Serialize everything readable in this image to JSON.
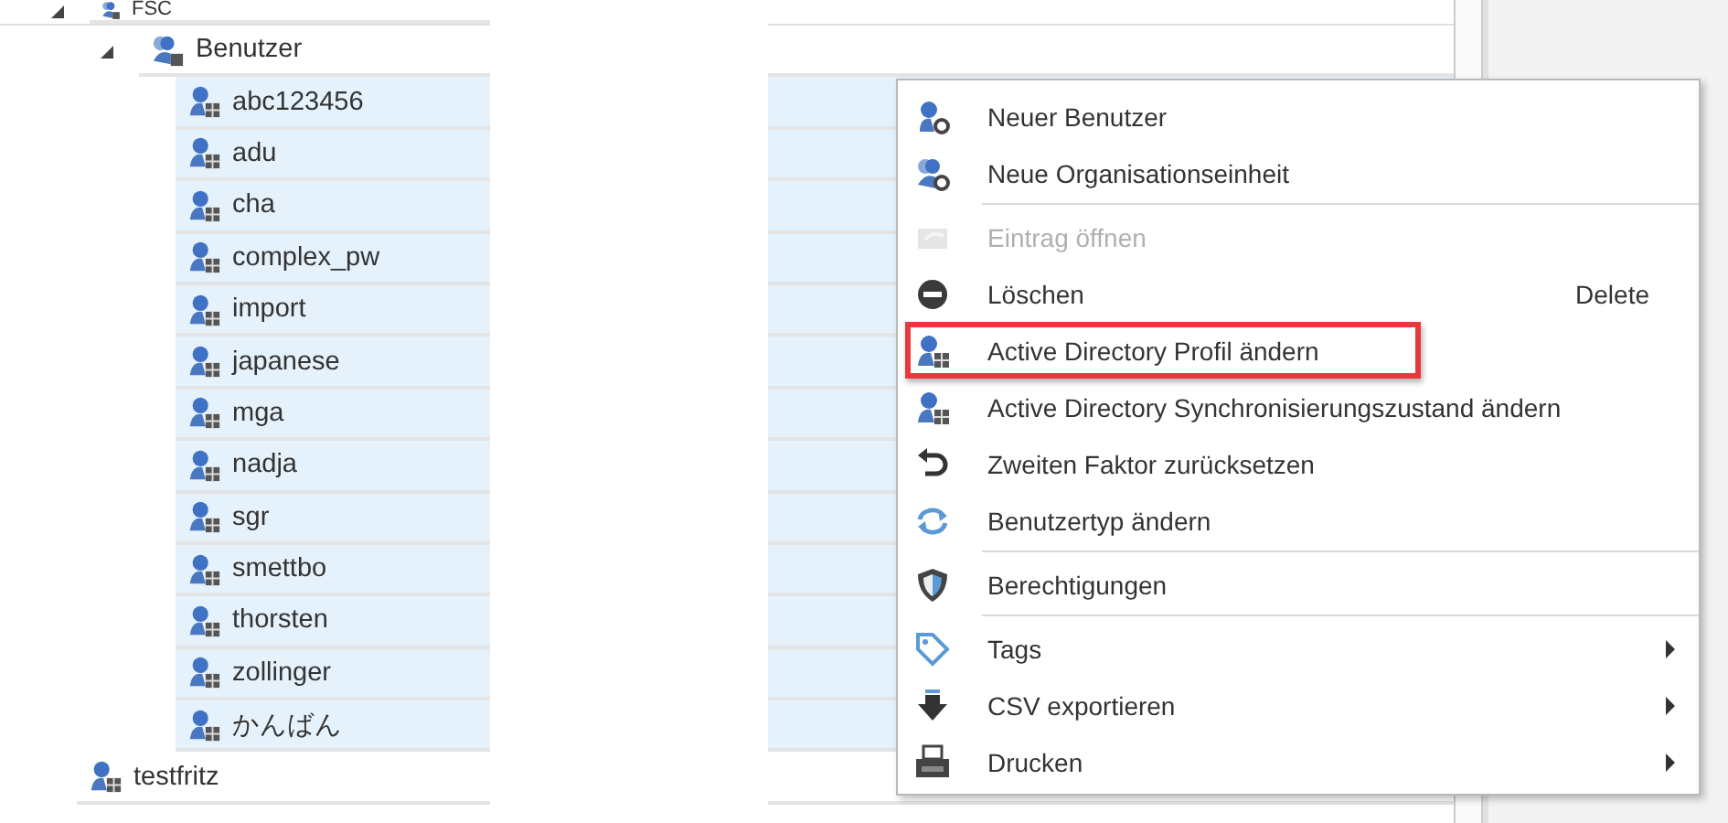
{
  "tree": [
    {
      "label": "FSC",
      "expanded": true,
      "selected": false,
      "children": [
        {
          "label": "Benutzer",
          "expanded": true,
          "selected": false,
          "children": [
            {
              "label": "abc123456",
              "selected": true
            },
            {
              "label": "adu",
              "selected": true
            },
            {
              "label": "cha",
              "selected": true
            },
            {
              "label": "complex_pw",
              "selected": true
            },
            {
              "label": "import",
              "selected": true
            },
            {
              "label": "japanese",
              "selected": true
            },
            {
              "label": "mga",
              "selected": true
            },
            {
              "label": "nadja",
              "selected": true
            },
            {
              "label": "sgr",
              "selected": true
            },
            {
              "label": "smettbo",
              "selected": true
            },
            {
              "label": "thorsten",
              "selected": true
            },
            {
              "label": "zollinger",
              "selected": true
            },
            {
              "label": "かんばん",
              "selected": true
            }
          ]
        }
      ]
    },
    {
      "label": "testfritz",
      "selected": false
    }
  ],
  "context_menu": [
    {
      "kind": "item",
      "label": "Neuer Benutzer",
      "disabled": false
    },
    {
      "kind": "item",
      "label": "Neue Organisationseinheit",
      "disabled": false
    },
    {
      "kind": "separator"
    },
    {
      "kind": "item",
      "label": "Eintrag öffnen",
      "disabled": true
    },
    {
      "kind": "item",
      "label": "Löschen",
      "disabled": false,
      "shortcut": "Delete"
    },
    {
      "kind": "item",
      "label": "Active Directory Profil ändern",
      "disabled": false,
      "highlighted": true
    },
    {
      "kind": "item",
      "label": "Active Directory Synchronisierungszustand ändern",
      "disabled": false
    },
    {
      "kind": "item",
      "label": "Zweiten Faktor zurücksetzen",
      "disabled": false
    },
    {
      "kind": "item",
      "label": "Benutzertyp ändern",
      "disabled": false
    },
    {
      "kind": "separator"
    },
    {
      "kind": "item",
      "label": "Berechtigungen",
      "disabled": false
    },
    {
      "kind": "separator"
    },
    {
      "kind": "item",
      "label": "Tags",
      "disabled": false,
      "submenu": true
    },
    {
      "kind": "item",
      "label": "CSV exportieren",
      "disabled": false,
      "submenu": true
    },
    {
      "kind": "item",
      "label": "Drucken",
      "disabled": false,
      "submenu": true
    }
  ]
}
